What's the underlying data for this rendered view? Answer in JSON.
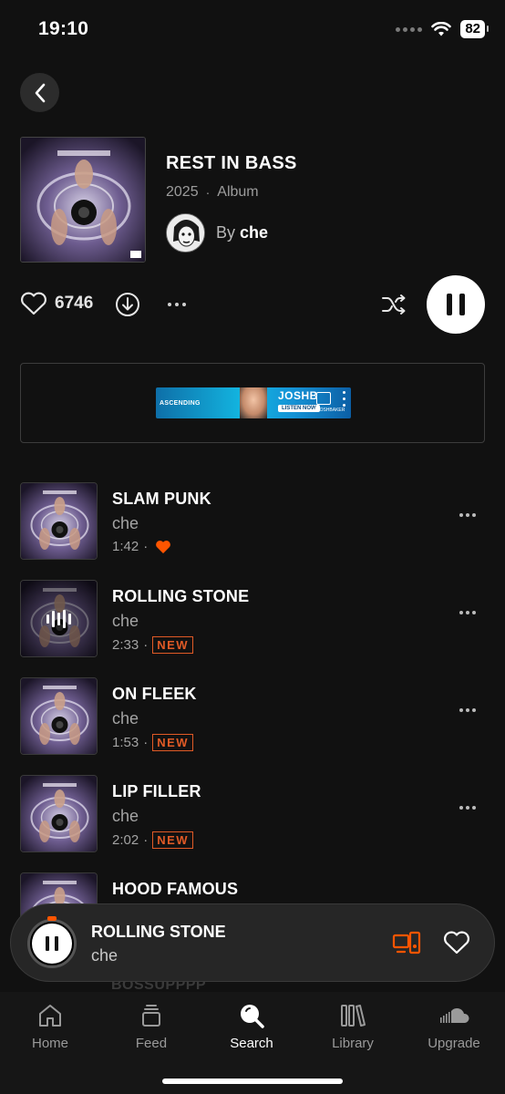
{
  "status_bar": {
    "time": "19:10",
    "battery": "82"
  },
  "album": {
    "title": "REST IN BASS",
    "year": "2025",
    "separator": "·",
    "type": "Album",
    "by_label": "By",
    "artist": "che"
  },
  "actions": {
    "like_count": "6746"
  },
  "ad": {
    "left_text": "ASCENDING",
    "name": "JOSHB",
    "cta": "LISTEN NOW",
    "handle": "@JOSHBAKER"
  },
  "tracks": [
    {
      "title": "SLAM PUNK",
      "artist": "che",
      "duration": "1:42",
      "separator": "·",
      "liked": true,
      "badge": ""
    },
    {
      "title": "ROLLING STONE",
      "artist": "che",
      "duration": "2:33",
      "separator": "·",
      "liked": false,
      "badge": "NEW",
      "now_playing": true
    },
    {
      "title": "ON FLEEK",
      "artist": "che",
      "duration": "1:53",
      "separator": "·",
      "liked": false,
      "badge": "NEW"
    },
    {
      "title": "LIP FILLER",
      "artist": "che",
      "duration": "2:02",
      "separator": "·",
      "liked": false,
      "badge": "NEW"
    },
    {
      "title": "HOOD FAMOUS",
      "artist": "",
      "duration": "",
      "badge": ""
    }
  ],
  "mini_player": {
    "title": "ROLLING STONE",
    "artist": "che",
    "progress": 0.03
  },
  "bleed_text": "BOSSUPPPP",
  "tabs": [
    {
      "label": "Home",
      "icon": "home-icon"
    },
    {
      "label": "Feed",
      "icon": "feed-icon"
    },
    {
      "label": "Search",
      "icon": "search-icon",
      "active": true
    },
    {
      "label": "Library",
      "icon": "library-icon"
    },
    {
      "label": "Upgrade",
      "icon": "soundcloud-icon"
    }
  ],
  "colors": {
    "accent": "#ff5500",
    "badge": "#e05a26",
    "background": "#111111"
  }
}
